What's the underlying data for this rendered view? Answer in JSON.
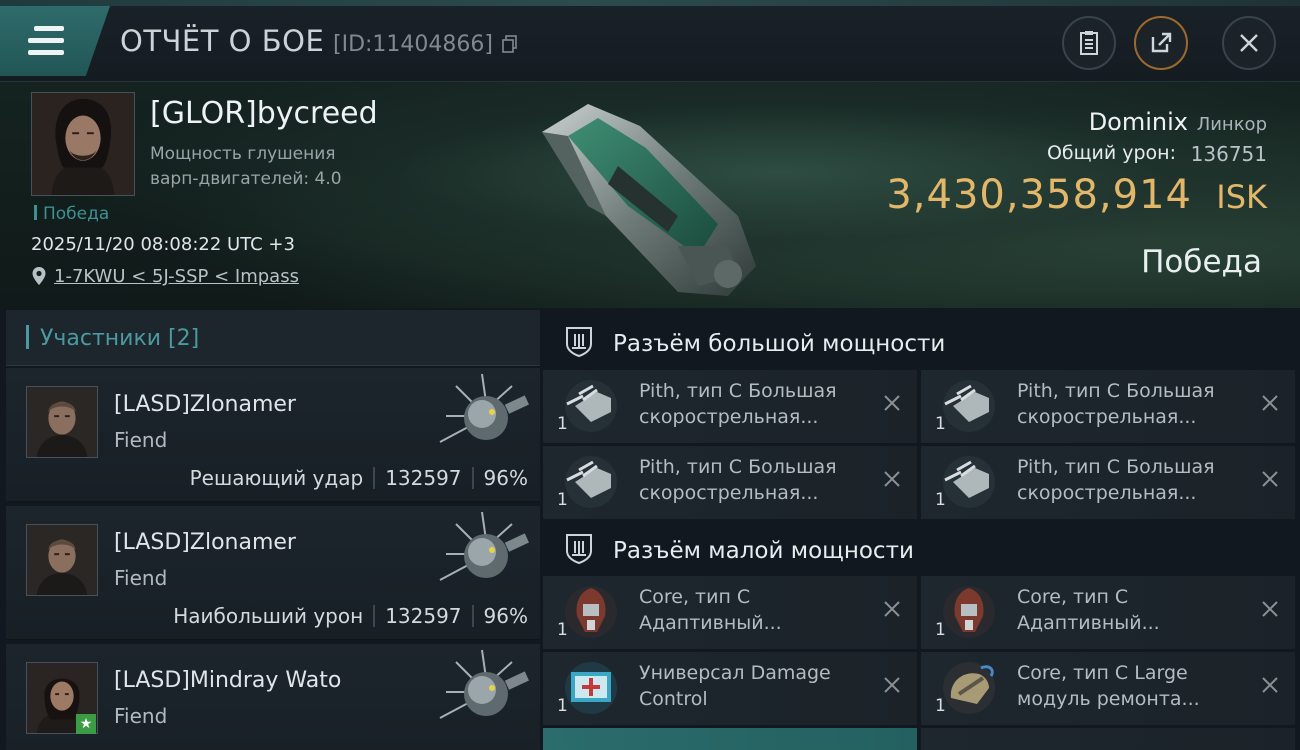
{
  "header": {
    "title": "ОТЧЁТ О БОЕ",
    "report_id": "[ID:11404866]",
    "icons": [
      "menu-icon",
      "copy-icon",
      "clipboard-icon",
      "share-icon",
      "close-icon"
    ]
  },
  "victim": {
    "name": "[GLOR]bycreed",
    "stat_line1": "Мощность глушения",
    "stat_line2": "варп-двигателей: 4.0",
    "tag": "Победа",
    "datetime": "2025/11/20 08:08:22 UTC +3",
    "location": "1-7KWU < 5J-SSP < Impass",
    "ship_name": "Dominix",
    "ship_class": "Линкор",
    "damage_label": "Общий урон:",
    "damage_value": "136751",
    "isk_value": "3,430,358,914",
    "isk_unit": "ISK",
    "result": "Победа"
  },
  "participants": {
    "title": "Участники [2]",
    "items": [
      {
        "name": "[LASD]Zlonamer",
        "ship": "Fiend",
        "role": "Решающий удар",
        "damage": "132597",
        "percent": "96%"
      },
      {
        "name": "[LASD]Zlonamer",
        "ship": "Fiend",
        "role": "Наибольший урон",
        "damage": "132597",
        "percent": "96%"
      },
      {
        "name": "[LASD]Mindray Wato",
        "ship": "Fiend"
      }
    ]
  },
  "fitting": {
    "high_title": "Разъём большой мощности",
    "low_title": "Разъём малой мощности",
    "high": [
      {
        "line1": "Pith, тип C Большая",
        "line2": "скорострельная...",
        "qty": "1"
      },
      {
        "line1": "Pith, тип C Большая",
        "line2": "скорострельная...",
        "qty": "1"
      },
      {
        "line1": "Pith, тип C Большая",
        "line2": "скорострельная...",
        "qty": "1"
      },
      {
        "line1": "Pith, тип C Большая",
        "line2": "скорострельная...",
        "qty": "1"
      }
    ],
    "low": [
      {
        "line1": "Core, тип C",
        "line2": "Адаптивный...",
        "qty": "1"
      },
      {
        "line1": "Core, тип C",
        "line2": "Адаптивный...",
        "qty": "1"
      },
      {
        "line1": "Универсал Damage",
        "line2": "Control",
        "qty": "1"
      },
      {
        "line1": "Core, тип C Large",
        "line2": "модуль ремонта...",
        "qty": "1"
      }
    ]
  },
  "colors": {
    "accent_teal": "#2f6b6b",
    "isk_gold": "#e2b769",
    "participants_teal": "#4b9aa0"
  }
}
